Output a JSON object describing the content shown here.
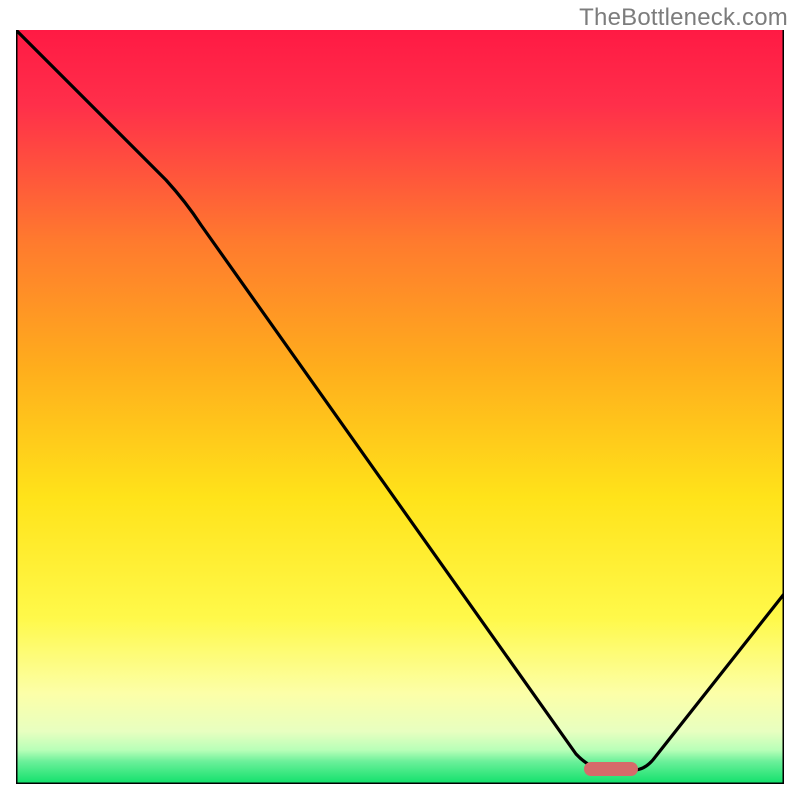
{
  "watermark": "TheBottleneck.com",
  "chart_data": {
    "type": "line",
    "title": "",
    "xlabel": "",
    "ylabel": "",
    "xlim": [
      0,
      100
    ],
    "ylim": [
      0,
      100
    ],
    "grid": false,
    "legend": false,
    "series": [
      {
        "name": "bottleneck-curve",
        "x": [
          0,
          20,
          75,
          80,
          100
        ],
        "y": [
          100,
          80,
          2,
          2,
          25
        ]
      }
    ],
    "marker": {
      "name": "optimal-marker",
      "x_range": [
        74,
        80
      ],
      "y": 2.2,
      "color": "#d66a6a"
    },
    "background_gradient": {
      "top": "#ff2445",
      "mid_upper": "#ff9a1f",
      "mid": "#ffe61a",
      "lower": "#fbff9a",
      "bottom_band": "#0fe06a"
    },
    "axes_visible": {
      "left": true,
      "bottom": true,
      "right": true,
      "top": false
    }
  }
}
